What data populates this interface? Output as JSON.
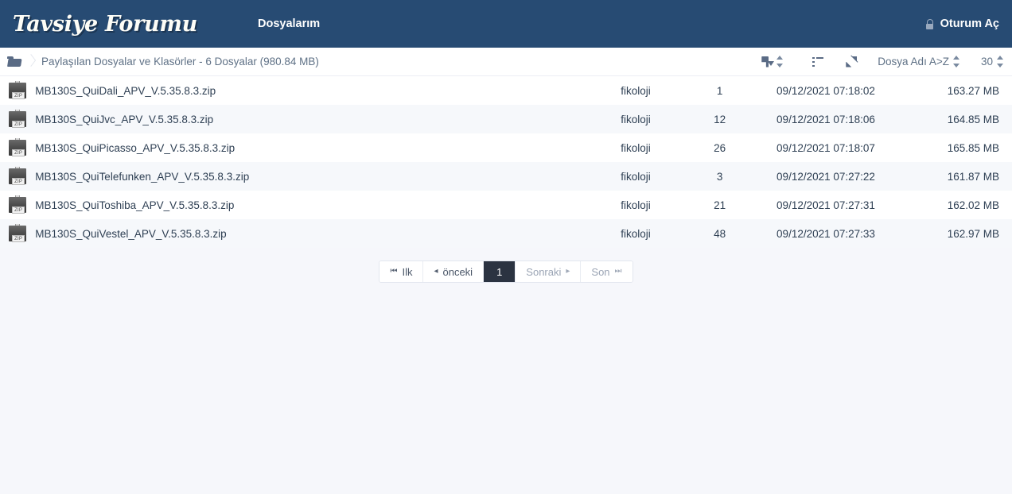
{
  "navbar": {
    "brand": "Tavsiye Forumu",
    "links": [
      {
        "label": "Dosyalarım",
        "name": "nav-link-my-files"
      }
    ],
    "login_label": "Oturum Aç",
    "bg_color": "#274b73"
  },
  "toolbar": {
    "breadcrumb": "Paylaşılan Dosyalar ve Klasörler - 6 Dosyalar (980.84 MB)",
    "sort_label": "Dosya Adı A>Z",
    "per_page": "30"
  },
  "files": {
    "rows": [
      {
        "name": "MB130S_QuiDali_APV_V.5.35.8.3.zip",
        "owner": "fikoloji",
        "count": "1",
        "date": "09/12/2021 07:18:02",
        "size": "163.27 MB",
        "icon_label": "ZIP"
      },
      {
        "name": "MB130S_QuiJvc_APV_V.5.35.8.3.zip",
        "owner": "fikoloji",
        "count": "12",
        "date": "09/12/2021 07:18:06",
        "size": "164.85 MB",
        "icon_label": "ZIP"
      },
      {
        "name": "MB130S_QuiPicasso_APV_V.5.35.8.3.zip",
        "owner": "fikoloji",
        "count": "26",
        "date": "09/12/2021 07:18:07",
        "size": "165.85 MB",
        "icon_label": "ZIP"
      },
      {
        "name": "MB130S_QuiTelefunken_APV_V.5.35.8.3.zip",
        "owner": "fikoloji",
        "count": "3",
        "date": "09/12/2021 07:27:22",
        "size": "161.87 MB",
        "icon_label": "ZIP"
      },
      {
        "name": "MB130S_QuiToshiba_APV_V.5.35.8.3.zip",
        "owner": "fikoloji",
        "count": "21",
        "date": "09/12/2021 07:27:31",
        "size": "162.02 MB",
        "icon_label": "ZIP"
      },
      {
        "name": "MB130S_QuiVestel_APV_V.5.35.8.3.zip",
        "owner": "fikoloji",
        "count": "48",
        "date": "09/12/2021 07:27:33",
        "size": "162.97 MB",
        "icon_label": "ZIP"
      }
    ]
  },
  "pagination": {
    "first": "Ilk",
    "previous": "önceki",
    "current": "1",
    "next": "Sonraki",
    "last": "Son",
    "active_bg": "#2b3341"
  }
}
